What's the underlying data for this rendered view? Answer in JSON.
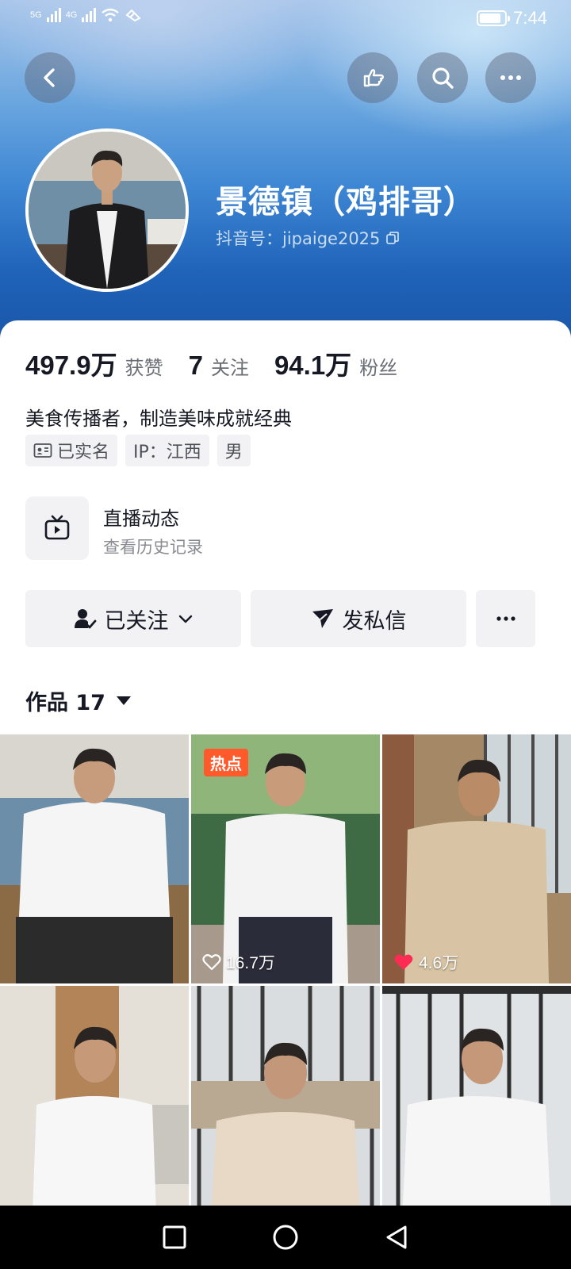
{
  "status_bar": {
    "network_1": "5G",
    "network_2": "4G",
    "time": "7:44"
  },
  "top_actions": {
    "back_icon": "chevron-left-icon",
    "share_icon": "pointing-hand-icon",
    "search_icon": "search-icon",
    "more_icon": "more-horizontal-icon"
  },
  "profile": {
    "nickname": "景德镇（鸡排哥）",
    "douyin_id": "抖音号：jipaige2025"
  },
  "stats": [
    {
      "value": "497.9万",
      "label": "获赞"
    },
    {
      "value": "7",
      "label": "关注"
    },
    {
      "value": "94.1万",
      "label": "粉丝"
    }
  ],
  "bio": "美食传播者，制造美味成就经典",
  "tags": {
    "verified": "已实名",
    "ip": "IP：江西",
    "gender": "男"
  },
  "live": {
    "title": "直播动态",
    "subtitle": "查看历史记录"
  },
  "actions": {
    "follow": "已关注",
    "message": "发私信"
  },
  "works": {
    "label": "作品 17"
  },
  "videos": [
    {
      "hot": "",
      "likes": ""
    },
    {
      "hot": "热点",
      "likes": "16.7万",
      "liked": false
    },
    {
      "hot": "",
      "likes": "4.6万",
      "liked": true
    },
    {
      "hot": "",
      "likes": ""
    },
    {
      "hot": "",
      "likes": ""
    },
    {
      "hot": "",
      "likes": ""
    }
  ],
  "colors": {
    "accent_hot": "#fe5a2c",
    "like_red": "#fe2c55",
    "header_blue": "#2a6fc4"
  }
}
